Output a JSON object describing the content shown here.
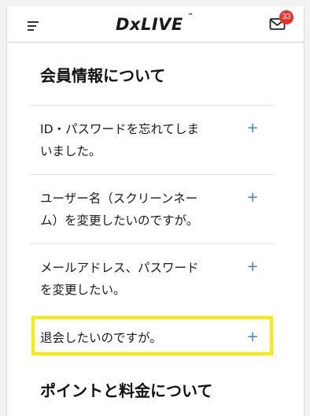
{
  "header": {
    "logo_text": "DxLIVE",
    "logo_tm": "™",
    "mail_badge_count": "33",
    "menu_icon": "hamburger-menu-icon",
    "mail_icon": "envelope-icon"
  },
  "sections": [
    {
      "title": "会員情報について",
      "items": [
        {
          "line1": "ID・パスワードを忘れてしま",
          "line2": "いました。",
          "toggle": "+"
        },
        {
          "line1": "ユーザー名（スクリーンネー",
          "line2": "ム）を変更したいのですが。",
          "toggle": "+"
        },
        {
          "line1": "メールアドレス、パスワード",
          "line2": "を変更したい。",
          "toggle": "+"
        },
        {
          "line1": "退会したいのですが。",
          "toggle": "+"
        }
      ]
    },
    {
      "title": "ポイントと料金について"
    }
  ],
  "colors": {
    "accent_plus": "#4a7fc2",
    "badge": "#e8332a",
    "highlight": "#ffeb00"
  }
}
